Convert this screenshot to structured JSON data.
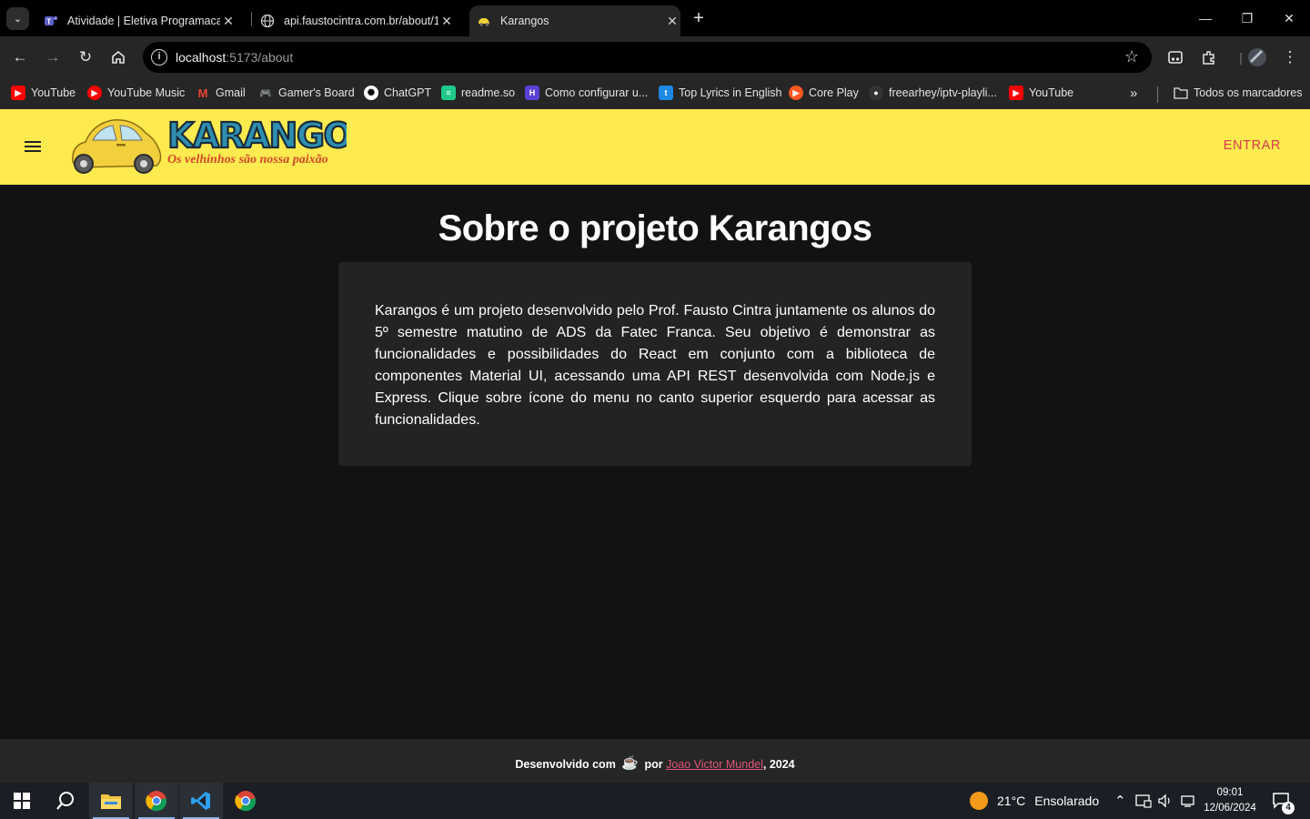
{
  "browser": {
    "tabs": [
      {
        "title": "Atividade | Eletiva Programacao",
        "favicon": "teams-icon",
        "active": false
      },
      {
        "title": "api.faustocintra.com.br/about/1",
        "favicon": "globe-icon",
        "active": false
      },
      {
        "title": "Karangos",
        "favicon": "car-icon",
        "active": true
      }
    ],
    "url_host": "localhost",
    "url_rest": ":5173/about",
    "bookmarks": [
      {
        "label": "YouTube",
        "color": "#ff0000"
      },
      {
        "label": "YouTube Music",
        "color": "#ff0000"
      },
      {
        "label": "Gmail",
        "color": "#ea4335"
      },
      {
        "label": "Gamer's Board",
        "color": "#444444"
      },
      {
        "label": "ChatGPT",
        "color": "#ffffff"
      },
      {
        "label": "readme.so",
        "color": "#1ec98a"
      },
      {
        "label": "Como configurar u...",
        "color": "#5b3fd6"
      },
      {
        "label": "Top Lyrics in English",
        "color": "#1e88e5"
      },
      {
        "label": "Core Play",
        "color": "#ff5722"
      },
      {
        "label": "freearhey/iptv-playli...",
        "color": "#333333"
      },
      {
        "label": "YouTube",
        "color": "#ff0000"
      }
    ],
    "all_bookmarks": "Todos os marcadores"
  },
  "app": {
    "logo_text": "KARANGOS",
    "logo_tagline": "Os velhinhos são nossa paixão",
    "login_label": "ENTRAR",
    "title": "Sobre o projeto Karangos",
    "description": "Karangos é um projeto desenvolvido pelo Prof. Fausto Cintra juntamente os alunos do 5º semestre matutino de ADS da Fatec Franca. Seu objetivo é demonstrar as funcionalidades e possibilidades do React em conjunto com a biblioteca de componentes Material UI, acessando uma API REST desenvolvida com Node.js e Express. Clique sobre ícone do menu no canto superior esquerdo para acessar as funcionalidades.",
    "colors": {
      "appbar": "#ffeb4f",
      "accent": "#d83a4b",
      "background": "#121212",
      "card": "#232323"
    }
  },
  "footer": {
    "prefix": "Desenvolvido com",
    "by": "por",
    "author": "Joao Victor Mundel",
    "year": ", 2024"
  },
  "taskbar": {
    "weather_temp": "21°C",
    "weather_text": "Ensolarado",
    "time": "09:01",
    "date": "12/06/2024",
    "notifications": "4"
  }
}
